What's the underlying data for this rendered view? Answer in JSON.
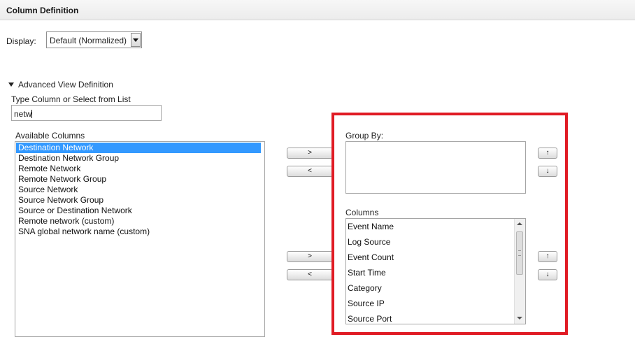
{
  "header": {
    "title": "Column Definition"
  },
  "display": {
    "label": "Display:",
    "selected": "Default (Normalized)"
  },
  "advanced": {
    "toggle_label": "Advanced View Definition"
  },
  "search": {
    "label": "Type Column or Select from List",
    "value": "netw"
  },
  "available": {
    "label": "Available Columns",
    "items": [
      "Destination Network",
      "Destination Network Group",
      "Remote Network",
      "Remote Network Group",
      "Source Network",
      "Source Network Group",
      "Source or Destination Network",
      "Remote network (custom)",
      "SNA global network name (custom)"
    ],
    "selected_index": 0
  },
  "buttons": {
    "add": ">",
    "remove": "<",
    "move_up": "↑",
    "move_down": "↓"
  },
  "group_by": {
    "label": "Group By:"
  },
  "columns": {
    "label": "Columns",
    "items": [
      "Event Name",
      "Log Source",
      "Event Count",
      "Start Time",
      "Category",
      "Source IP",
      "Source Port"
    ]
  },
  "colors": {
    "highlight": "#e01b24",
    "selection": "#3399ff"
  }
}
